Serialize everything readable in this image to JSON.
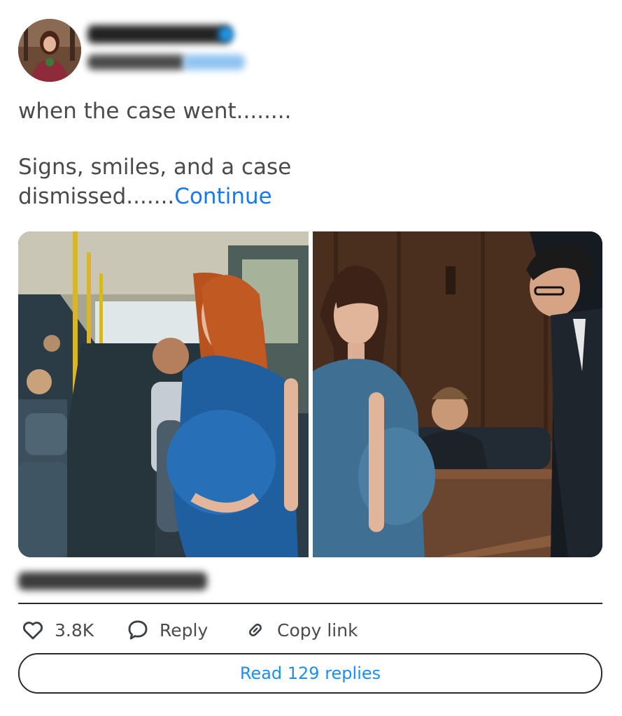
{
  "tweet": {
    "text_line1": "when the case went........",
    "text_line2": "Signs, smiles, and a case",
    "text_line3": "dismissed.......",
    "continue_label": "Continue"
  },
  "media": {
    "left_image": "woman-on-bus-photo",
    "right_image": "woman-in-courtroom-photo"
  },
  "actions": {
    "like_count": "3.8K",
    "reply_label": "Reply",
    "copy_link_label": "Copy link"
  },
  "read_replies_label": "Read 129 replies",
  "colors": {
    "link": "#1877f2",
    "read_replies_text": "#1d8ef0",
    "text": "#4a4a4a"
  },
  "icons": [
    "heart-icon",
    "speech-bubble-icon",
    "link-icon"
  ]
}
